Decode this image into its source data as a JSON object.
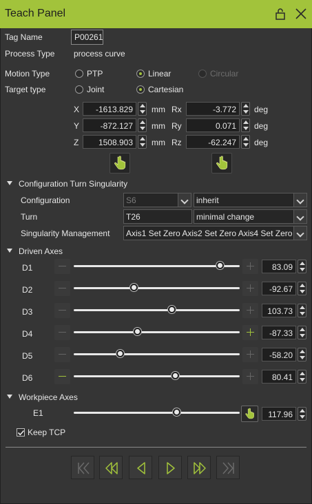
{
  "window": {
    "title": "Teach Panel",
    "icons": [
      "lock-icon",
      "close-icon"
    ]
  },
  "tag": {
    "label": "Tag Name",
    "value": "P00261"
  },
  "process": {
    "label": "Process Type",
    "value": "process curve"
  },
  "motion": {
    "label": "Motion Type",
    "options": [
      "PTP",
      "Linear",
      "Circular"
    ],
    "selected": "Linear"
  },
  "target": {
    "label": "Target type",
    "options": [
      "Joint",
      "Cartesian"
    ],
    "selected": "Cartesian"
  },
  "pose": {
    "x": {
      "label": "X",
      "value": "-1613.829",
      "unit": "mm"
    },
    "y": {
      "label": "Y",
      "value": "-872.127",
      "unit": "mm"
    },
    "z": {
      "label": "Z",
      "value": "1508.903",
      "unit": "mm"
    },
    "rx": {
      "label": "Rx",
      "value": "-3.772",
      "unit": "deg"
    },
    "ry": {
      "label": "Ry",
      "value": "0.071",
      "unit": "deg"
    },
    "rz": {
      "label": "Rz",
      "value": "-62.247",
      "unit": "deg"
    }
  },
  "config_section": {
    "title": "Configuration Turn Singularity",
    "configuration_label": "Configuration",
    "configuration_value": "S6",
    "configuration_mode": "inherit",
    "turn_label": "Turn",
    "turn_value": "T26",
    "turn_mode": "minimal change",
    "singularity_label": "Singularity Management",
    "singularity_value": "Axis1 Set Zero Axis2 Set Zero Axis4 Set Zero"
  },
  "driven_axes": {
    "title": "Driven Axes",
    "axes": [
      {
        "name": "D1",
        "value": "83.09",
        "slider_fraction": 0.88
      },
      {
        "name": "D2",
        "value": "-92.67",
        "slider_fraction": 0.36
      },
      {
        "name": "D3",
        "value": "103.73",
        "slider_fraction": 0.59
      },
      {
        "name": "D4",
        "value": "-87.33",
        "slider_fraction": 0.38
      },
      {
        "name": "D5",
        "value": "-58.20",
        "slider_fraction": 0.28
      },
      {
        "name": "D6",
        "value": "80.41",
        "slider_fraction": 0.61
      }
    ]
  },
  "workpiece_axes": {
    "title": "Workpiece Axes",
    "axes": [
      {
        "name": "E1",
        "value": "117.96",
        "slider_fraction": 0.62
      }
    ]
  },
  "keep_tcp": {
    "label": "Keep TCP",
    "checked": true
  },
  "nav_buttons": [
    "first-icon",
    "step-back-fast-icon",
    "step-back-icon",
    "step-forward-icon",
    "step-forward-fast-icon",
    "last-icon"
  ],
  "colors": {
    "accent": "#a2c33b",
    "background": "#353535"
  }
}
